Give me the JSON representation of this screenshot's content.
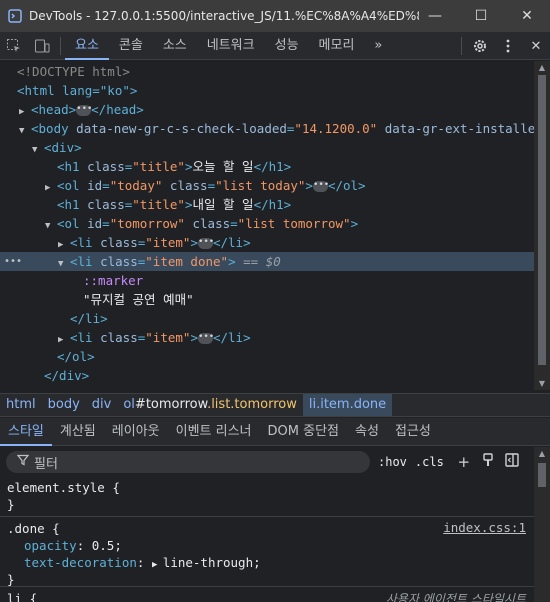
{
  "window": {
    "app_name": "DevTools",
    "title": "DevTools - 127.0.0.1:5500/interactive_JS/11.%EC%8A%A4%ED%83%8...",
    "minimize": "—",
    "maximize": "☐",
    "close": "✕"
  },
  "tabs": [
    "요소",
    "콘솔",
    "소스",
    "네트워크",
    "성능",
    "메모리"
  ],
  "tabs_more": "»",
  "tree": {
    "doctype": "<!DOCTYPE html>",
    "html_open": "<html lang=\"ko\">",
    "head_open": "<head>",
    "head_close": "</head>",
    "body_tag": "<body",
    "body_attr1_name": "data-new-gr-c-s-check-loaded",
    "body_attr1_val": "\"14.1200.0\"",
    "body_attr2_name": "data-gr-ext-installed",
    "div_open": "<div>",
    "h1_tag": "<h1",
    "h1_class_attr": "class",
    "h1_class_val": "\"title\"",
    "h1_today_text": "오늘 할 일",
    "h1_close": "</h1>",
    "ol_tag": "<ol",
    "id_attr": "id",
    "today_id": "\"today\"",
    "class_attr": "class",
    "today_class": "\"list today\"",
    "ol_close": "</ol>",
    "h1_tomorrow_text": "내일 할 일",
    "tomorrow_id": "\"tomorrow\"",
    "tomorrow_class": "\"list tomorrow\"",
    "li_tag": "<li",
    "li_item_class": "\"item\"",
    "li_close": "</li>",
    "li_done_class": "\"item done\"",
    "eq_zero": "== $0",
    "marker": "::marker",
    "done_text": "\"뮤지컬 공연 예매\"",
    "div_close": "</div>",
    "more_dots": "•••",
    "ellipsis": "•••"
  },
  "breadcrumbs": [
    {
      "text": "html"
    },
    {
      "text": "body"
    },
    {
      "text": "div"
    },
    {
      "tag": "ol",
      "id": "#tomorrow",
      "cls": ".list.tomorrow"
    },
    {
      "text": "li.item.done"
    }
  ],
  "subtabs": [
    "스타일",
    "계산됨",
    "레이아웃",
    "이벤트 리스너",
    "DOM 중단점",
    "속성",
    "접근성"
  ],
  "filter": {
    "placeholder": "필터",
    "hov": ":hov",
    "cls": ".cls"
  },
  "styles": {
    "element_style": "element.style {",
    "close_brace": "}",
    "done_selector": ".done {",
    "done_source": "index.css:1",
    "opacity_name": "opacity",
    "opacity_value": "0.5;",
    "textdec_name": "text-decoration",
    "textdec_value": "line-through;",
    "li_selector": "li {",
    "li_source": "사용자 에이전트 스타일시트"
  },
  "colors": {
    "accent": "#8ab4f8",
    "tag": "#5db0d7",
    "attr_value": "#f29766",
    "selection": "#394a5c"
  }
}
